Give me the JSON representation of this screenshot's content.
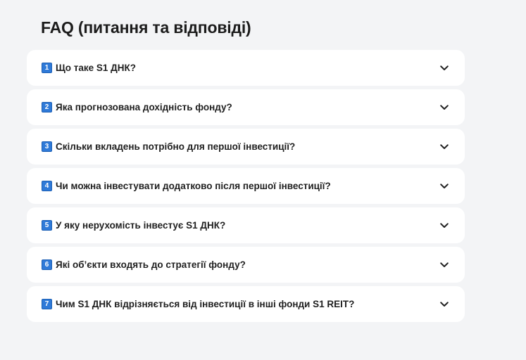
{
  "faq": {
    "title": "FAQ (питання та відповіді)",
    "items": [
      {
        "number": "1",
        "question": "Що таке S1 ДНК?"
      },
      {
        "number": "2",
        "question": "Яка прогнозована дохідність фонду?"
      },
      {
        "number": "3",
        "question": "Скільки вкладень потрібно для першої інвестиції?"
      },
      {
        "number": "4",
        "question": "Чи можна інвестувати додатково після першої інвестиції?"
      },
      {
        "number": "5",
        "question": "У яку нерухомість інвестує S1 ДНК?"
      },
      {
        "number": "6",
        "question": "Які об’єкти входять до стратегії фонду?"
      },
      {
        "number": "7",
        "question": "Чим S1 ДНК відрізняється від інвестиції в інші фонди S1 REIT?"
      }
    ]
  },
  "colors": {
    "background": "#f3f4f6",
    "card": "#ffffff",
    "badge": "#2f7ad8",
    "text": "#1f1f1f"
  },
  "icons": {
    "expand": "chevron-down-icon"
  }
}
